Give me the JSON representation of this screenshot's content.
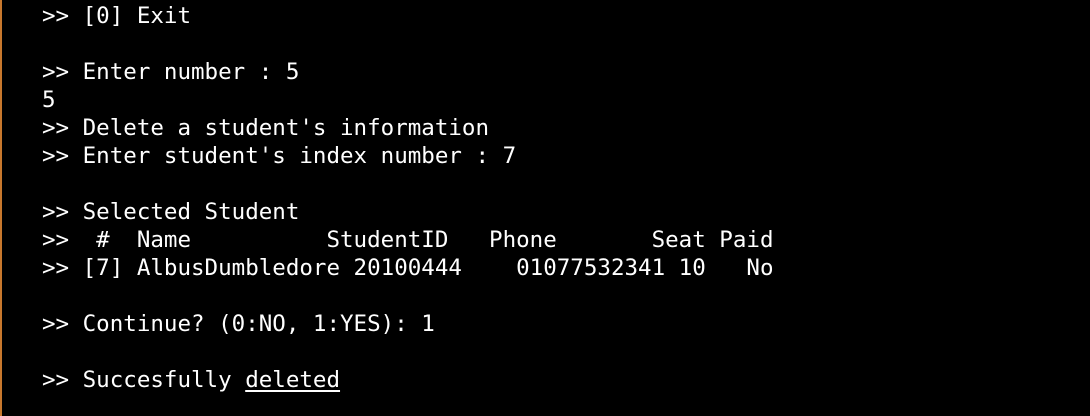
{
  "terminal": {
    "lines": [
      ">> [0] Exit",
      "",
      ">> Enter number : 5",
      "5",
      ">> Delete a student's information",
      ">> Enter student's index number : 7",
      "",
      ">> Selected Student",
      ">>  #  Name          StudentID   Phone       Seat Paid",
      ">> [7] AlbusDumbledore 20100444    01077532341 10   No",
      "",
      ">> Continue? (0:NO, 1:YES): 1",
      "",
      ">> Succesfully "
    ],
    "last_line_underlined": "deleted"
  }
}
